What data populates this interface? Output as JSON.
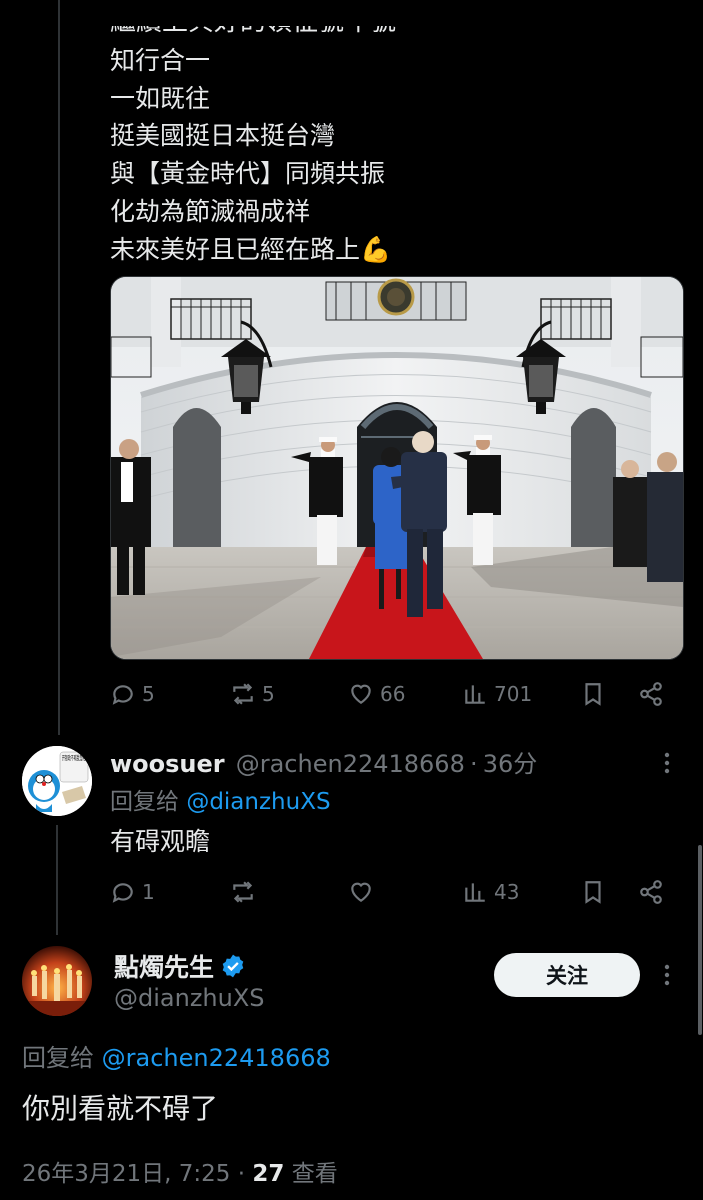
{
  "tweet": {
    "clipped_line": "繼續上與好的領征號年號",
    "lines": [
      "知行合一",
      "一如既往",
      "挺美國挺日本挺台灣",
      "與【黃金時代】同頻共振",
      "化劫為節滅禍成祥",
      "未來美好且已經在路上💪"
    ],
    "actions": {
      "replies": "5",
      "retweets": "5",
      "likes": "66",
      "views": "701"
    }
  },
  "reply1": {
    "avatar_text": "开银政不喊我是吧?",
    "name": "woosuer",
    "handle": "@rachen22418668",
    "dot": "·",
    "time": "36分",
    "reply_to_label": "回复给",
    "reply_to_user": "@dianzhuXS",
    "text": "有碍观瞻",
    "actions": {
      "replies": "1",
      "retweets": "",
      "likes": "",
      "views": "43"
    }
  },
  "main_reply": {
    "name": "點燭先生",
    "handle": "@dianzhuXS",
    "follow_label": "关注",
    "reply_to_label": "回复给",
    "reply_to_user": "@rachen22418668",
    "text": "你別看就不碍了",
    "timestamp": "26年3月21日, 7:25",
    "dot": "·",
    "view_count": "27",
    "view_label": "查看"
  },
  "colors": {
    "background": "#000000",
    "text": "#e7e9ea",
    "muted": "#71767b",
    "link": "#1d9bf0",
    "verified": "#1d9bf0",
    "carpet": "#c8151b"
  }
}
